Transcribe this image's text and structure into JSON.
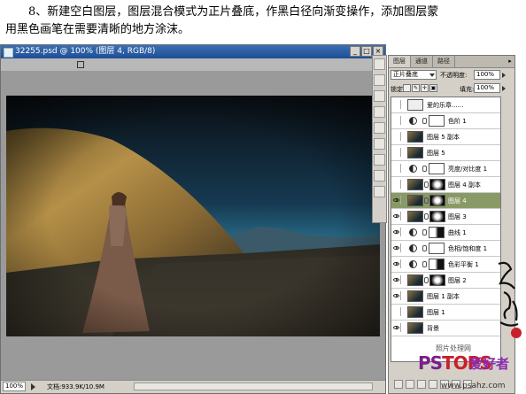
{
  "instruction": {
    "line1": "8、新建空白图层，图层混合模式为正片叠底，作黑白径向渐变操作，添加图层蒙",
    "line2": "用黑色画笔在需要清晰的地方涂沫。"
  },
  "document": {
    "title": "32255.psd @ 100% (图层 4, RGB/8)",
    "zoom": "100%",
    "doc_info": "文档:933.9K/10.9M"
  },
  "layers_panel": {
    "tabs": [
      "图层",
      "通道",
      "路径"
    ],
    "blend_mode": "正片叠底",
    "opacity_label": "不透明度:",
    "opacity_value": "100%",
    "lock_label": "锁定:",
    "fill_label": "填充:",
    "fill_value": "100%",
    "layers": [
      {
        "name": "爱的乐章......",
        "kind": "text",
        "visible": false,
        "selected": false
      },
      {
        "name": "色阶 1",
        "kind": "adjustment",
        "visible": false,
        "selected": false
      },
      {
        "name": "图层 5 副本",
        "kind": "image",
        "visible": false,
        "selected": false
      },
      {
        "name": "图层 5",
        "kind": "image",
        "visible": false,
        "selected": false
      },
      {
        "name": "亮度/对比度 1",
        "kind": "adjustment",
        "visible": false,
        "selected": false
      },
      {
        "name": "图层 4 副本",
        "kind": "image-mask",
        "visible": false,
        "selected": false
      },
      {
        "name": "图层 4",
        "kind": "image-mask",
        "visible": true,
        "selected": true
      },
      {
        "name": "图层 3",
        "kind": "image-mask",
        "visible": true,
        "selected": false
      },
      {
        "name": "曲线 1",
        "kind": "adjustment-mask",
        "visible": true,
        "selected": false
      },
      {
        "name": "色相/饱和度 1",
        "kind": "adjustment",
        "visible": true,
        "selected": false
      },
      {
        "name": "色彩平衡 1",
        "kind": "adjustment-mask",
        "visible": true,
        "selected": false
      },
      {
        "name": "图层 2",
        "kind": "image-mask",
        "visible": true,
        "selected": false
      },
      {
        "name": "图层 1 副本",
        "kind": "image",
        "visible": true,
        "selected": false
      },
      {
        "name": "图层 1",
        "kind": "image",
        "visible": false,
        "selected": false
      },
      {
        "name": "背景",
        "kind": "image",
        "visible": true,
        "selected": false
      }
    ]
  },
  "watermark": {
    "caption": "照片处理网",
    "logo": "PS",
    "logo2": "TOPS",
    "cn": "爱好者",
    "url": "www.psahz.com"
  },
  "colors": {
    "selected_layer": "#8a9a66",
    "title_bar": "#1d4f96",
    "panel_bg": "#d4d0c8"
  }
}
